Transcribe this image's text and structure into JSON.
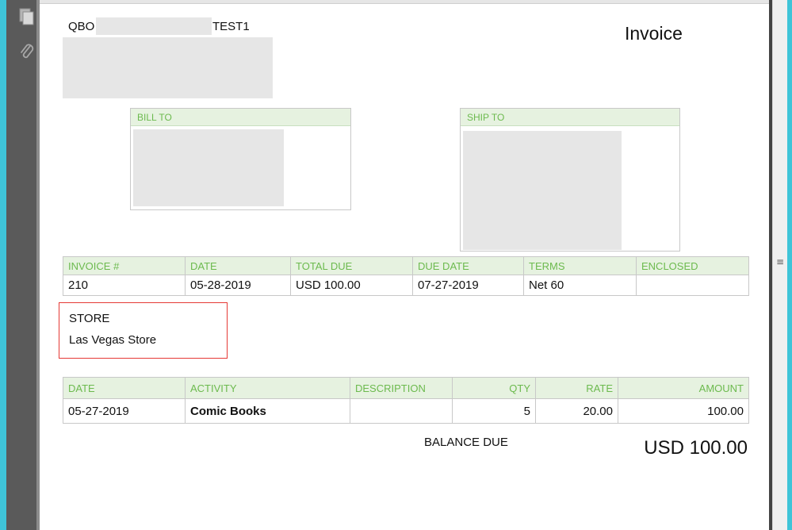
{
  "toolbar": {
    "icons": [
      "pages-icon",
      "paperclip-icon"
    ]
  },
  "invoice": {
    "company_prefix": "QBO",
    "company_suffix": "TEST1",
    "title": "Invoice",
    "bill_to_label": "BILL TO",
    "ship_to_label": "SHIP TO",
    "summary": {
      "headers": [
        "INVOICE #",
        "DATE",
        "TOTAL DUE",
        "DUE DATE",
        "TERMS",
        "ENCLOSED"
      ],
      "values": [
        "210",
        "05-28-2019",
        "USD 100.00",
        "07-27-2019",
        "Net 60",
        ""
      ]
    },
    "store": {
      "label": "STORE",
      "value": "Las Vegas Store"
    },
    "lines": {
      "headers": [
        "DATE",
        "ACTIVITY",
        "DESCRIPTION",
        "QTY",
        "RATE",
        "AMOUNT"
      ],
      "rows": [
        [
          "05-27-2019",
          "Comic Books",
          "",
          "5",
          "20.00",
          "100.00"
        ]
      ]
    },
    "balance_due_label": "BALANCE DUE",
    "balance_due_value": "USD 100.00"
  },
  "colors": {
    "header_bg": "#e6f2e0",
    "header_text": "#6cba4e",
    "highlight_border": "#e53935",
    "window_accent": "#3fc4d8"
  }
}
